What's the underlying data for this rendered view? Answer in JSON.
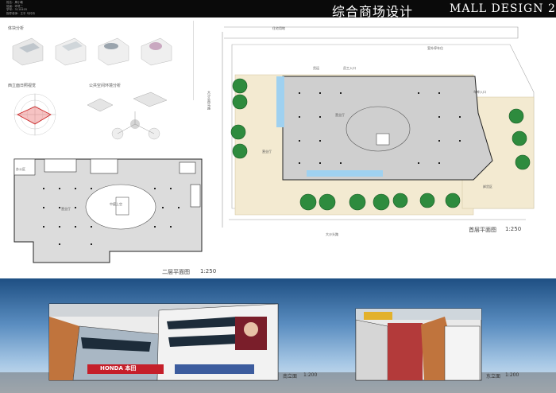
{
  "header": {
    "title_cn": "综合商场设计",
    "title_en": "MALL DESIGN 2",
    "info_lines": [
      "姓名：周小敏",
      "班级：环境二",
      "学号：3110405",
      "指导老师：王平 马玲玲"
    ]
  },
  "analysis": {
    "volume_label": "体块分析",
    "elevation_label": "西立面日照视觉",
    "space_label": "公共空间环境分析"
  },
  "site": {
    "roads": [
      "住宅用地",
      "大沙头西马路",
      "大沙头路"
    ],
    "labels": [
      "室外停车位",
      "货运",
      "员工入口",
      "车库入口",
      "营业厅",
      "营业厅",
      "卸货区"
    ]
  },
  "plans": {
    "ground": {
      "title": "首层平面图",
      "scale": "1:250"
    },
    "second": {
      "title": "二层平面图",
      "scale": "1:250",
      "labels": [
        "营业厅",
        "中庭上空",
        "办公区"
      ]
    }
  },
  "elevations": {
    "south": {
      "title": "南立面",
      "scale": "1:200",
      "sign": "HONDA 本田"
    },
    "east": {
      "title": "东立面",
      "scale": "1:200"
    }
  }
}
